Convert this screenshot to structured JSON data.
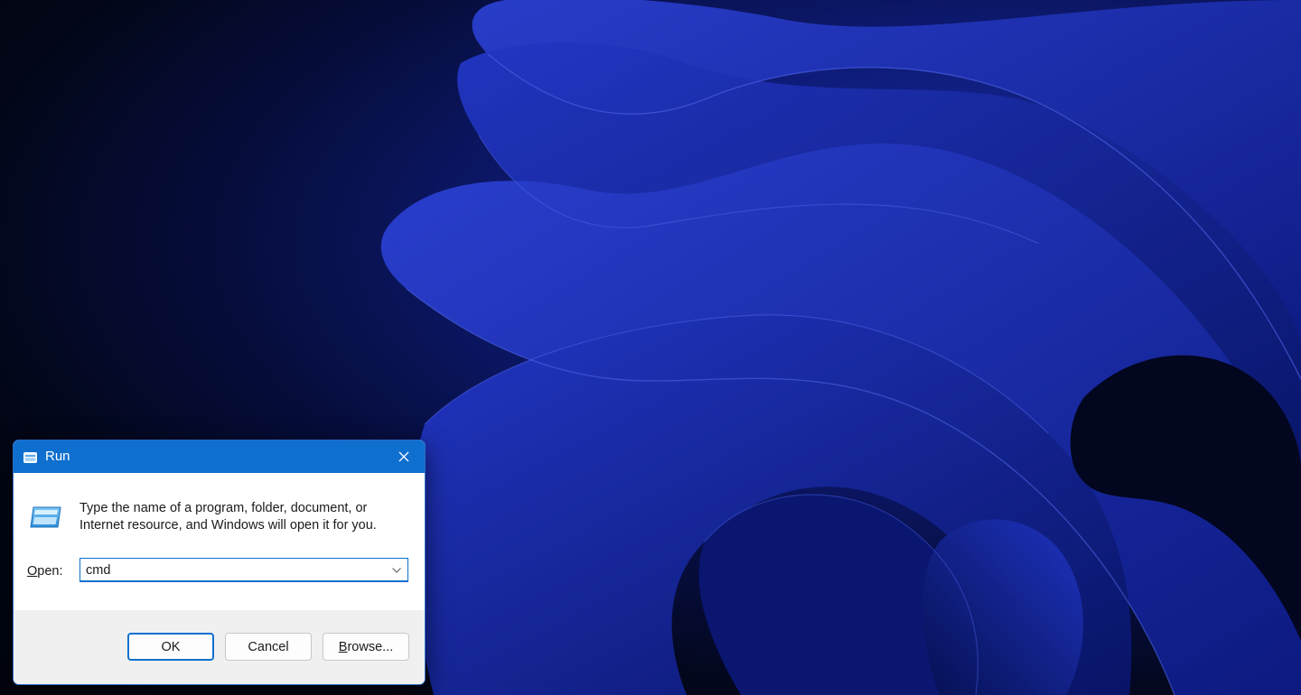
{
  "desktop": {
    "wallpaper": "windows-11-bloom-blue"
  },
  "dialog": {
    "title": "Run",
    "description_line1": "Type the name of a program, folder, document, or",
    "description_line2": "Internet resource, and Windows will open it for you.",
    "open_label_mnemonic": "O",
    "open_label_rest": "pen:",
    "open_value": "cmd",
    "buttons": {
      "ok": "OK",
      "cancel": "Cancel",
      "browse_mnemonic": "B",
      "browse_rest": "rowse..."
    },
    "icons": {
      "title": "run-icon",
      "main": "run-icon",
      "close": "close-icon",
      "dropdown": "chevron-down-icon"
    },
    "colors": {
      "titlebar": "#0f6fcf",
      "accent": "#0f6fcf",
      "footer": "#f0f0f0"
    }
  }
}
